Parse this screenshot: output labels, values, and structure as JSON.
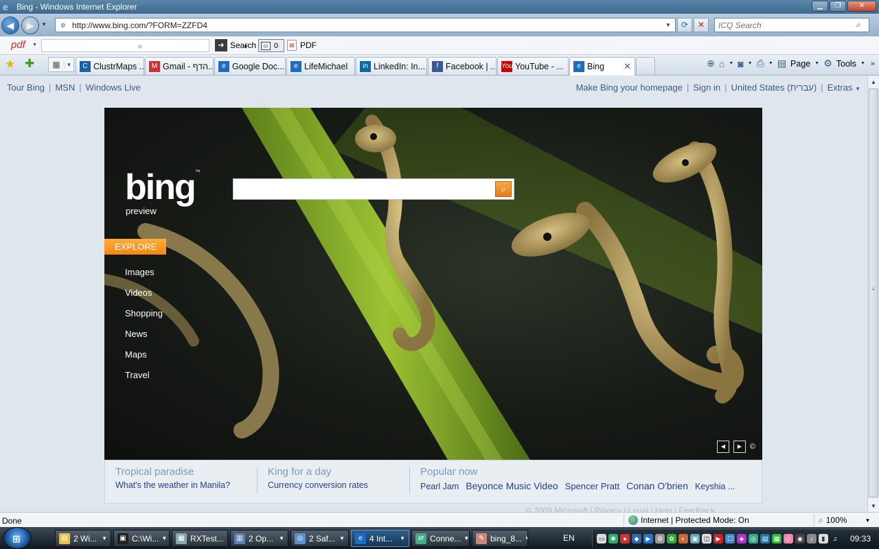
{
  "window": {
    "title": "Bing - Windows Internet Explorer",
    "controls": {
      "minimize": "▁",
      "maximize": "❐",
      "close": "✕"
    }
  },
  "addressbar": {
    "url": "http://www.bing.com/?FORM=ZZFD4",
    "search_placeholder": "ICQ Search"
  },
  "pdf_toolbar": {
    "logo": "pdf",
    "search_label": "Search",
    "popup_count": "0",
    "pdf_label": "PDF"
  },
  "tabs": [
    {
      "label": "ClustrMaps ...",
      "icon": "C",
      "icon_color": "#1f5fa8"
    },
    {
      "label": "Gmail - הדף...",
      "icon": "M",
      "icon_color": "#c33"
    },
    {
      "label": "Google Doc...",
      "icon": "e",
      "icon_color": "#1e6bc4"
    },
    {
      "label": "LifeMichael",
      "icon": "e",
      "icon_color": "#1e6bc4"
    },
    {
      "label": "LinkedIn: In...",
      "icon": "in",
      "icon_color": "#0b66a6"
    },
    {
      "label": "Facebook | ...",
      "icon": "f",
      "icon_color": "#3b5998"
    },
    {
      "label": "YouTube - ...",
      "icon": "You",
      "icon_color": "#c00"
    },
    {
      "label": "Bing",
      "icon": "e",
      "icon_color": "#1e6bc4",
      "active": true
    }
  ],
  "commandbar": {
    "page_label": "Page",
    "tools_label": "Tools"
  },
  "bing": {
    "top_links": [
      "Tour Bing",
      "MSN",
      "Windows Live"
    ],
    "right_links": [
      "Make Bing your homepage",
      "Sign in",
      "United States (עברית)",
      "Extras"
    ],
    "logo": "bing",
    "logo_tm": "™",
    "preview": "preview",
    "explore": "EXPLORE",
    "explore_links": [
      "Images",
      "Videos",
      "Shopping",
      "News",
      "Maps",
      "Travel"
    ],
    "hero_copyright": "©",
    "bottom": {
      "col1_heading": "Tropical paradise",
      "col1_link": "What's the weather in Manila?",
      "col2_heading": "King for a day",
      "col2_link": "Currency conversion rates",
      "col3_heading": "Popular now",
      "popular": [
        "Pearl Jam",
        "Beyonce Music Video",
        "Spencer Pratt",
        "Conan O'brien",
        "Keyshia ..."
      ]
    },
    "footer": "© 2009 Microsoft  |  Privacy  |  Legal  |  Help  |  Feedback"
  },
  "statusbar": {
    "status": "Done",
    "zone": "Internet | Protected Mode: On",
    "zoom": "100%"
  },
  "taskbar": {
    "items": [
      {
        "label": "2 Wi...",
        "icon": "▤",
        "icon_color": "#e8c048",
        "width": 82
      },
      {
        "label": "C:\\Wi...",
        "icon": "▣",
        "icon_color": "#222",
        "width": 82
      },
      {
        "label": "RXTest...",
        "icon": "▦",
        "icon_color": "#8aa",
        "width": 82
      },
      {
        "label": "2 Op...",
        "icon": "▥",
        "icon_color": "#5a7fb0",
        "width": 85
      },
      {
        "label": "2 Saf...",
        "icon": "◎",
        "icon_color": "#5a8fd0",
        "width": 85
      },
      {
        "label": "4 Int...",
        "icon": "e",
        "icon_color": "#1e6bc4",
        "width": 85,
        "active": true
      },
      {
        "label": "Conne...",
        "icon": "⇄",
        "icon_color": "#4a8",
        "width": 85
      },
      {
        "label": "bing_8...",
        "icon": "✎",
        "icon_color": "#c87",
        "width": 82
      }
    ],
    "lang": "EN",
    "clock": "09:33"
  }
}
